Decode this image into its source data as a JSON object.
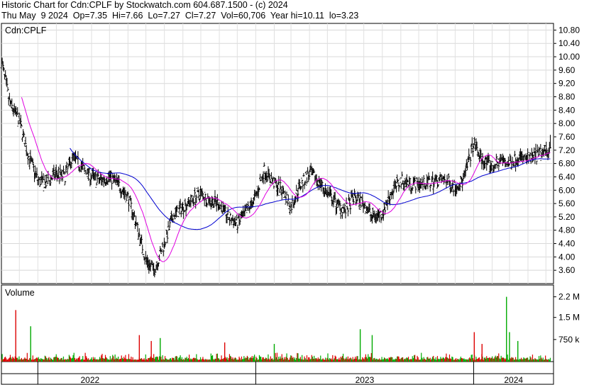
{
  "header": {
    "line1": "Historic Chart for Cdn:CPLF by Stockwatch.com 604.687.1500 - (c) 2024",
    "line2": "Thu May  9 2024  Op=7.35  Hi=7.66  Lo=7.27  Cl=7.27  Vol=60,706  Year hi=10.11  lo=3.23"
  },
  "chart_data": [
    {
      "type": "bar",
      "subtype": "ohlc",
      "title": "Cdn:CPLF",
      "ylim": [
        3.2,
        11.0
      ],
      "y_ticks": [
        "10.80",
        "10.40",
        "10.00",
        "9.60",
        "9.20",
        "8.80",
        "8.40",
        "8.00",
        "7.60",
        "7.20",
        "6.80",
        "6.40",
        "6.00",
        "5.60",
        "5.20",
        "4.80",
        "4.40",
        "4.00",
        "3.60"
      ],
      "x_ticks": [
        "2022",
        "2023",
        "2024"
      ],
      "grid": true,
      "price_path": [
        [
          "2021-11-01",
          9.9
        ],
        [
          "2021-11-15",
          8.6
        ],
        [
          "2021-12-01",
          8.1
        ],
        [
          "2021-12-15",
          7.1
        ],
        [
          "2022-01-01",
          6.3
        ],
        [
          "2022-01-15",
          6.2
        ],
        [
          "2022-02-01",
          6.5
        ],
        [
          "2022-02-15",
          6.4
        ],
        [
          "2022-03-01",
          7.0
        ],
        [
          "2022-03-15",
          6.7
        ],
        [
          "2022-04-01",
          6.4
        ],
        [
          "2022-04-15",
          6.3
        ],
        [
          "2022-05-01",
          6.4
        ],
        [
          "2022-05-15",
          6.2
        ],
        [
          "2022-06-01",
          5.8
        ],
        [
          "2022-06-15",
          5.0
        ],
        [
          "2022-07-01",
          3.9
        ],
        [
          "2022-07-15",
          3.6
        ],
        [
          "2022-08-01",
          4.4
        ],
        [
          "2022-08-15",
          5.2
        ],
        [
          "2022-09-01",
          5.5
        ],
        [
          "2022-09-15",
          5.7
        ],
        [
          "2022-10-01",
          5.9
        ],
        [
          "2022-10-15",
          5.7
        ],
        [
          "2022-11-01",
          5.6
        ],
        [
          "2022-11-15",
          5.2
        ],
        [
          "2022-12-01",
          5.0
        ],
        [
          "2022-12-15",
          5.3
        ],
        [
          "2023-01-01",
          5.8
        ],
        [
          "2023-01-15",
          6.6
        ],
        [
          "2023-02-01",
          6.2
        ],
        [
          "2023-02-15",
          6.0
        ],
        [
          "2023-03-01",
          5.5
        ],
        [
          "2023-03-15",
          6.1
        ],
        [
          "2023-04-01",
          6.5
        ],
        [
          "2023-04-15",
          6.3
        ],
        [
          "2023-05-01",
          5.9
        ],
        [
          "2023-05-15",
          5.6
        ],
        [
          "2023-06-01",
          5.4
        ],
        [
          "2023-06-15",
          5.8
        ],
        [
          "2023-07-01",
          5.6
        ],
        [
          "2023-07-15",
          5.2
        ],
        [
          "2023-08-01",
          5.3
        ],
        [
          "2023-08-15",
          5.9
        ],
        [
          "2023-09-01",
          6.3
        ],
        [
          "2023-09-15",
          6.2
        ],
        [
          "2023-10-01",
          6.2
        ],
        [
          "2023-10-15",
          6.2
        ],
        [
          "2023-11-01",
          6.3
        ],
        [
          "2023-11-15",
          6.3
        ],
        [
          "2023-12-01",
          6.1
        ],
        [
          "2023-12-15",
          6.3
        ],
        [
          "2024-01-01",
          7.4
        ],
        [
          "2024-01-15",
          6.9
        ],
        [
          "2024-02-01",
          6.7
        ],
        [
          "2024-02-15",
          6.9
        ],
        [
          "2024-03-01",
          6.8
        ],
        [
          "2024-03-15",
          7.0
        ],
        [
          "2024-04-01",
          6.9
        ],
        [
          "2024-05-09",
          7.27
        ]
      ],
      "series": [
        {
          "name": "",
          "type": "ma-short",
          "color": "#e000e0"
        },
        {
          "name": "",
          "type": "ma-long",
          "color": "#0000d0"
        }
      ]
    },
    {
      "type": "bar",
      "title": "Volume",
      "y_ticks": [
        "2.2 M",
        "1.5 M",
        "750 k"
      ],
      "y_tick_values": [
        2200000,
        1500000,
        750000
      ],
      "ylim": [
        0,
        2600000
      ],
      "up_color": "#00aa00",
      "down_color": "#dd0000",
      "spikes": [
        [
          "2021-11-25",
          1750000,
          "down"
        ],
        [
          "2021-12-20",
          1200000,
          "up"
        ],
        [
          "2022-06-20",
          900000,
          "down"
        ],
        [
          "2022-07-10",
          700000,
          "down"
        ],
        [
          "2022-07-25",
          800000,
          "up"
        ],
        [
          "2022-11-10",
          650000,
          "down"
        ],
        [
          "2023-02-01",
          600000,
          "up"
        ],
        [
          "2023-06-25",
          1100000,
          "up"
        ],
        [
          "2023-07-15",
          900000,
          "up"
        ],
        [
          "2024-01-02",
          1000000,
          "down"
        ],
        [
          "2024-01-15",
          600000,
          "down"
        ],
        [
          "2024-02-25",
          2200000,
          "up"
        ],
        [
          "2024-03-01",
          1000000,
          "up"
        ],
        [
          "2024-03-15",
          700000,
          "up"
        ]
      ]
    }
  ]
}
